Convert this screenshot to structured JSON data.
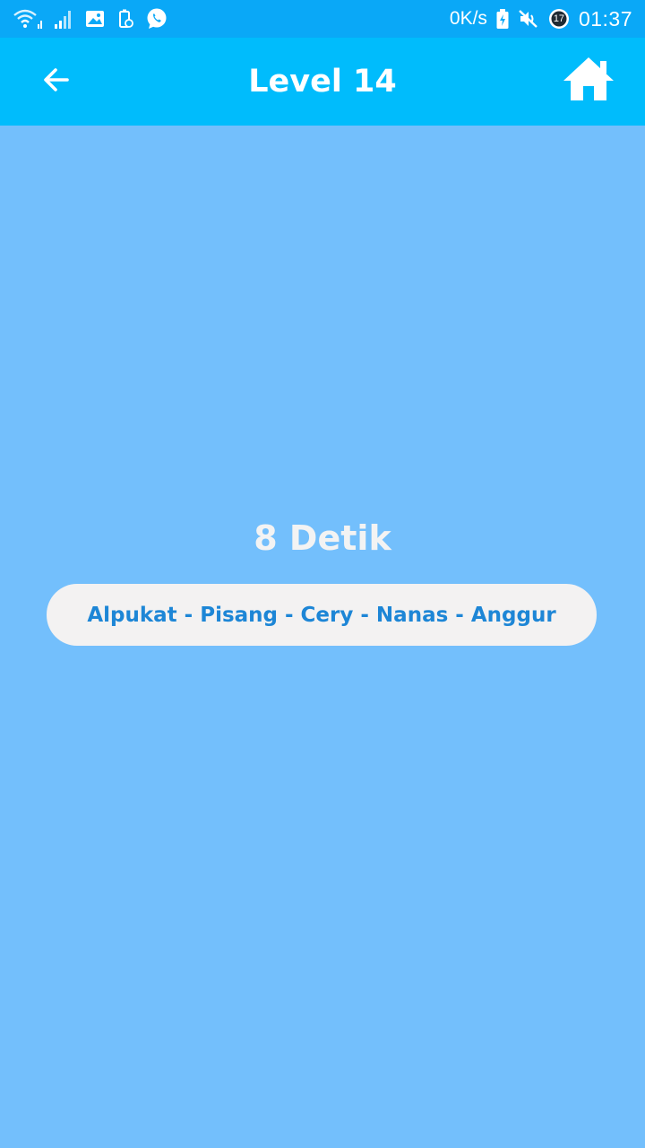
{
  "status_bar": {
    "net_speed": "0K/s",
    "time": "01:37",
    "notification_badge": "17",
    "left_icons": [
      "wifi-icon",
      "signal-icon",
      "gallery-icon",
      "battery-saver-icon",
      "whatsapp-icon"
    ],
    "right_icons": [
      "battery-charging-icon",
      "mute-icon",
      "alarm-icon"
    ]
  },
  "app_bar": {
    "title": "Level 14",
    "back_icon": "arrow-left-icon",
    "home_icon": "home-icon"
  },
  "game": {
    "timer": "8 Detik",
    "sequence": "Alpukat - Pisang - Cery - Nanas - Anggur"
  },
  "colors": {
    "status_bar": "#0aa8f7",
    "app_bar": "#00bcfc",
    "background": "#73bffc",
    "card": "#f3f2f2",
    "sequence_text": "#1d86d6"
  }
}
